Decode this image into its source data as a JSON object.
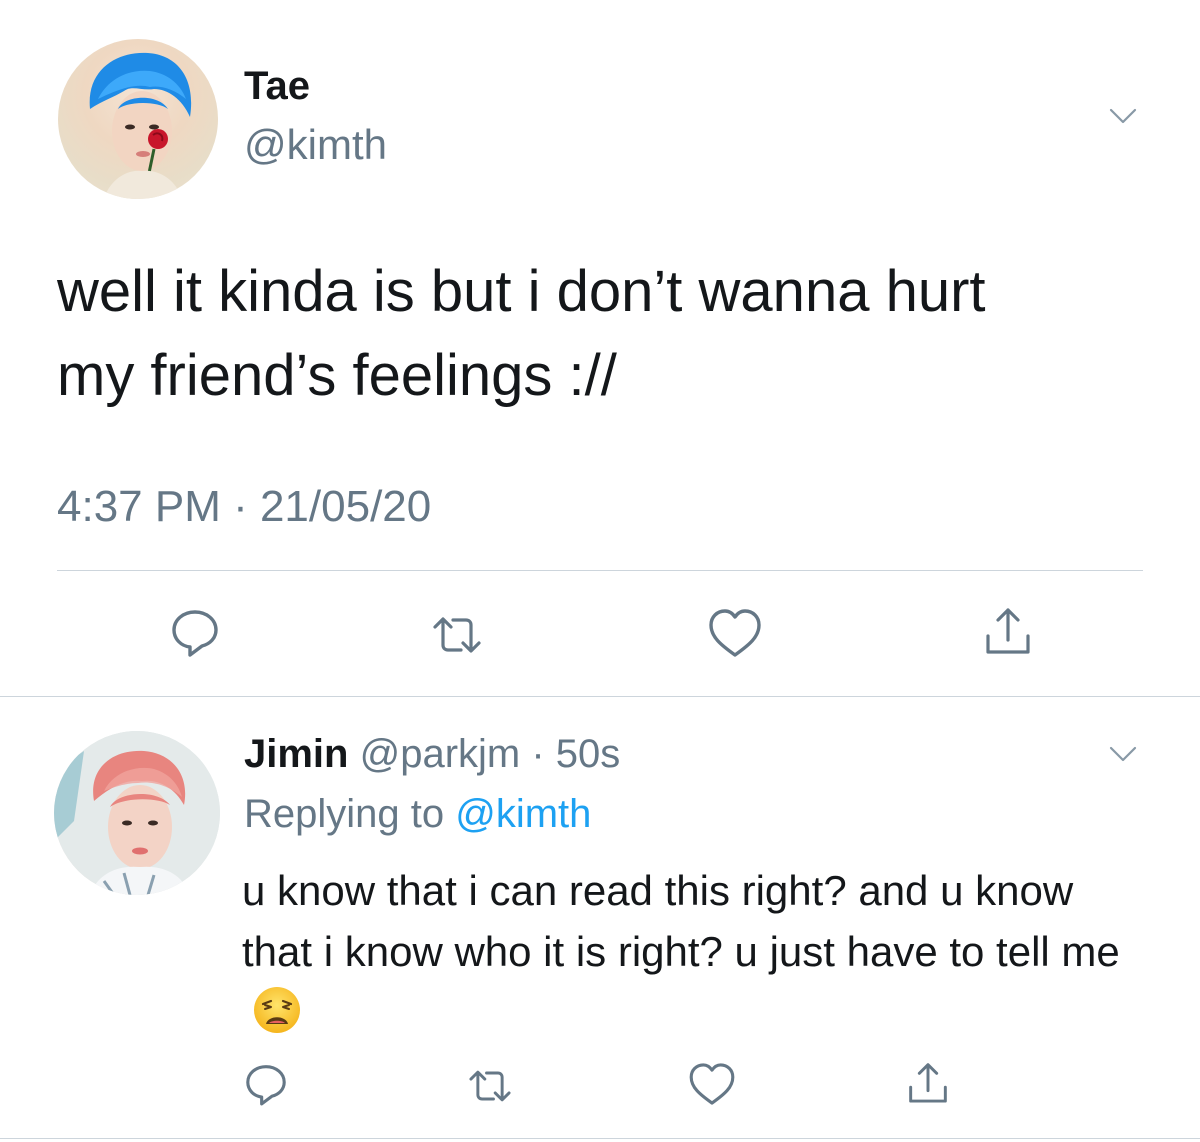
{
  "main_tweet": {
    "author_name": "Tae",
    "handle": "@kimth",
    "text": "well it kinda is but i don’t wanna hurt\nmy friend’s feelings ://",
    "timestamp": "4:37 PM · 21/05/20",
    "avatar": "profile-photo-blue-hair",
    "actions": [
      "reply-icon",
      "retweet-icon",
      "like-icon",
      "share-icon"
    ]
  },
  "reply_tweet": {
    "author_name": "Jimin",
    "handle": "@parkjm",
    "separator": " · ",
    "time_ago": "50s",
    "replying_prefix": "Replying to ",
    "replying_to": "@kimth",
    "text": "u know that i can read this right? and u know that i know who it is right? u just have to tell me",
    "emoji": "weary-face-emoji",
    "avatar": "profile-photo-pink-hair",
    "actions": [
      "reply-icon",
      "retweet-icon",
      "like-icon",
      "share-icon"
    ]
  },
  "colors": {
    "text_primary": "#14171a",
    "text_secondary": "#657786",
    "link": "#1da1f2",
    "divider": "#cdd5dc"
  }
}
